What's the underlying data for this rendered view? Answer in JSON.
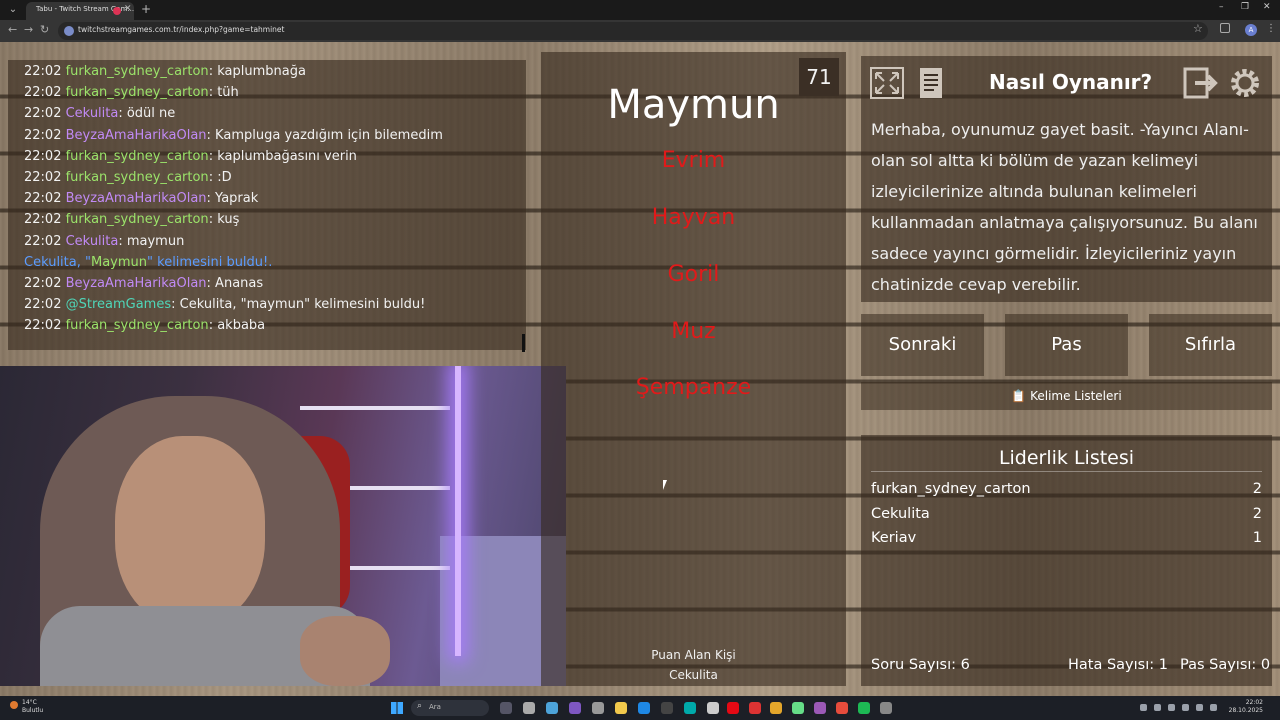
{
  "browser": {
    "tab_title": "Tabu - Twitch Stream Gam...",
    "tab_close": "✕",
    "new_tab": "+",
    "url": "twitchstreamgames.com.tr/index.php?game=tahminet",
    "profile_initial": "A",
    "window_controls": [
      "–",
      "❐",
      "✕"
    ]
  },
  "chat": {
    "messages": [
      {
        "time": "22:02",
        "user": "furkan_sydney_carton",
        "text": ": kaplumbnağa",
        "color": "#9be36a"
      },
      {
        "time": "22:02",
        "user": "furkan_sydney_carton",
        "text": ": tüh",
        "color": "#9be36a"
      },
      {
        "time": "22:02",
        "user": "Cekulita",
        "text": ": ödül ne",
        "color": "#c18af5"
      },
      {
        "time": "22:02",
        "user": "BeyzaAmaHarikaOlan",
        "text": ": Kampluga yazdığım için bilemedim",
        "color": "#c18af5"
      },
      {
        "time": "22:02",
        "user": "furkan_sydney_carton",
        "text": ": kaplumbağasını verin",
        "color": "#9be36a"
      },
      {
        "time": "22:02",
        "user": "furkan_sydney_carton",
        "text": ": :D",
        "color": "#9be36a"
      },
      {
        "time": "22:02",
        "user": "BeyzaAmaHarikaOlan",
        "text": ": Yaprak",
        "color": "#c18af5"
      },
      {
        "time": "22:02",
        "user": "furkan_sydney_carton",
        "text": ": kuş",
        "color": "#9be36a"
      },
      {
        "time": "22:02",
        "user": "Cekulita",
        "text": ": maymun",
        "color": "#c18af5"
      }
    ],
    "system": {
      "prefix": "Cekulita, \"",
      "word": "Maymun",
      "suffix": "\" kelimesini buldu!."
    },
    "messages2": [
      {
        "time": "22:02",
        "user": "BeyzaAmaHarikaOlan",
        "text": ": Ananas",
        "color": "#c18af5"
      },
      {
        "time": "22:02",
        "user": "@StreamGames",
        "text": ": Cekulita, \"maymun\" kelimesini buldu!",
        "color": "#4fd6b8"
      },
      {
        "time": "22:02",
        "user": "furkan_sydney_carton",
        "text": ": akbaba",
        "color": "#9be36a"
      }
    ]
  },
  "game": {
    "word": "Maymun",
    "timer": "71",
    "taboo_words": [
      "Evrim",
      "Hayvan",
      "Goril",
      "Muz",
      "Şempanze"
    ],
    "score_label": "Puan Alan Kişi",
    "score_name": "Cekulita"
  },
  "how_to": {
    "title": "Nasıl Oynanır?",
    "text": "Merhaba, oyunumuz gayet basit. -Yayıncı Alanı- olan sol altta ki bölüm de yazan kelimeyi izleyicilerinize altında bulunan kelimeleri kullanmadan anlatmaya çalışıyorsunuz. Bu alanı sadece yayıncı görmelidir. İzleyicileriniz yayın chatinizde cevap verebilir."
  },
  "controls": {
    "next": "Sonraki",
    "pass": "Pas",
    "reset": "Sıfırla",
    "lists": "📋 Kelime Listeleri"
  },
  "leaderboard": {
    "title": "Liderlik Listesi",
    "rows": [
      {
        "name": "furkan_sydney_carton",
        "score": "2"
      },
      {
        "name": "Cekulita",
        "score": "2"
      },
      {
        "name": "Keriav",
        "score": "1"
      }
    ],
    "question_count": "Soru Sayısı: 6",
    "error_count": "Hata Sayısı: 1",
    "pass_count": "Pas Sayısı: 0"
  },
  "taskbar": {
    "weather_temp": "14°C",
    "weather_desc": "Bulutlu",
    "search": "Ara",
    "time": "22:02",
    "date": "28.10.2025"
  }
}
